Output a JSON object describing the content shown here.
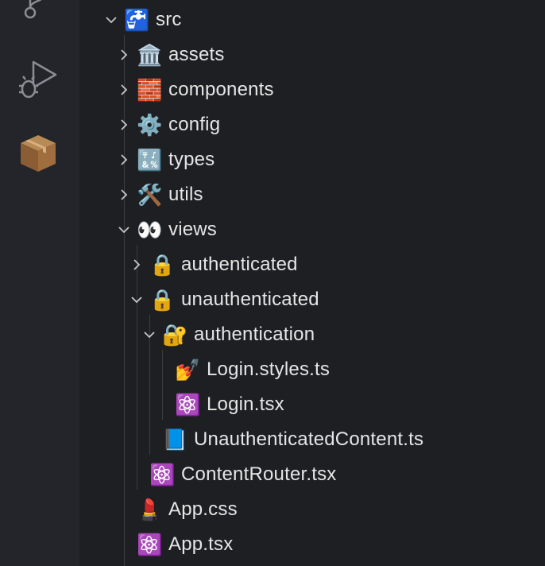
{
  "activity_bar": {
    "items": [
      {
        "name": "source-control",
        "icon": "git-branch-icon"
      },
      {
        "name": "run-and-debug",
        "icon": "run-debug-icon"
      },
      {
        "name": "extensions",
        "icon": "package-icon"
      }
    ]
  },
  "tree": [
    {
      "label": "src",
      "emoji": "🚰",
      "expanded": true
    },
    {
      "label": "assets",
      "emoji": "🏛️",
      "expanded": false
    },
    {
      "label": "components",
      "emoji": "🧱",
      "expanded": false
    },
    {
      "label": "config",
      "emoji": "⚙️",
      "expanded": false
    },
    {
      "label": "types",
      "emoji": "🔣",
      "expanded": false
    },
    {
      "label": "utils",
      "emoji": "🛠️",
      "expanded": false
    },
    {
      "label": "views",
      "emoji": "👀",
      "expanded": true
    },
    {
      "label": "authenticated",
      "emoji": "🔒",
      "expanded": false
    },
    {
      "label": "unauthenticated",
      "emoji": "🔒",
      "expanded": true
    },
    {
      "label": "authentication",
      "emoji": "🔐",
      "expanded": true
    },
    {
      "label": "Login.styles.ts",
      "emoji": "💅"
    },
    {
      "label": "Login.tsx",
      "emoji": "⚛️"
    },
    {
      "label": "UnauthenticatedContent.ts",
      "emoji": "📘"
    },
    {
      "label": "ContentRouter.tsx",
      "emoji": "⚛️"
    },
    {
      "label": "App.css",
      "emoji": "💄"
    },
    {
      "label": "App.tsx",
      "emoji": "⚛️"
    }
  ]
}
